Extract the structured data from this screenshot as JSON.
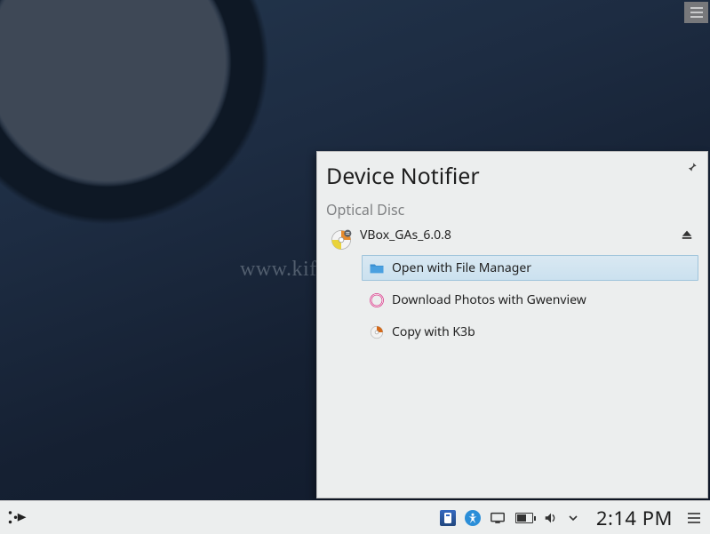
{
  "notifier": {
    "title": "Device Notifier",
    "category": "Optical Disc",
    "device_name": "VBox_GAs_6.0.8",
    "actions": [
      {
        "label": "Open with File Manager"
      },
      {
        "label": "Download Photos with Gwenview"
      },
      {
        "label": "Copy with K3b"
      }
    ]
  },
  "taskbar": {
    "clock": "2:14 PM"
  },
  "watermark": "www.kifarunix.com",
  "icons": {
    "pin": "pin-icon",
    "eject": "eject-icon",
    "disc": "optical-disc-icon",
    "file_manager": "file-manager-icon",
    "gwenview": "gwenview-icon",
    "k3b": "k3b-icon",
    "launcher": "application-launcher-icon",
    "usb": "usb-device-icon",
    "accessibility": "accessibility-icon",
    "display": "display-icon",
    "battery": "battery-icon",
    "volume": "volume-icon",
    "expand": "expand-tray-icon",
    "menu": "hamburger-icon"
  }
}
